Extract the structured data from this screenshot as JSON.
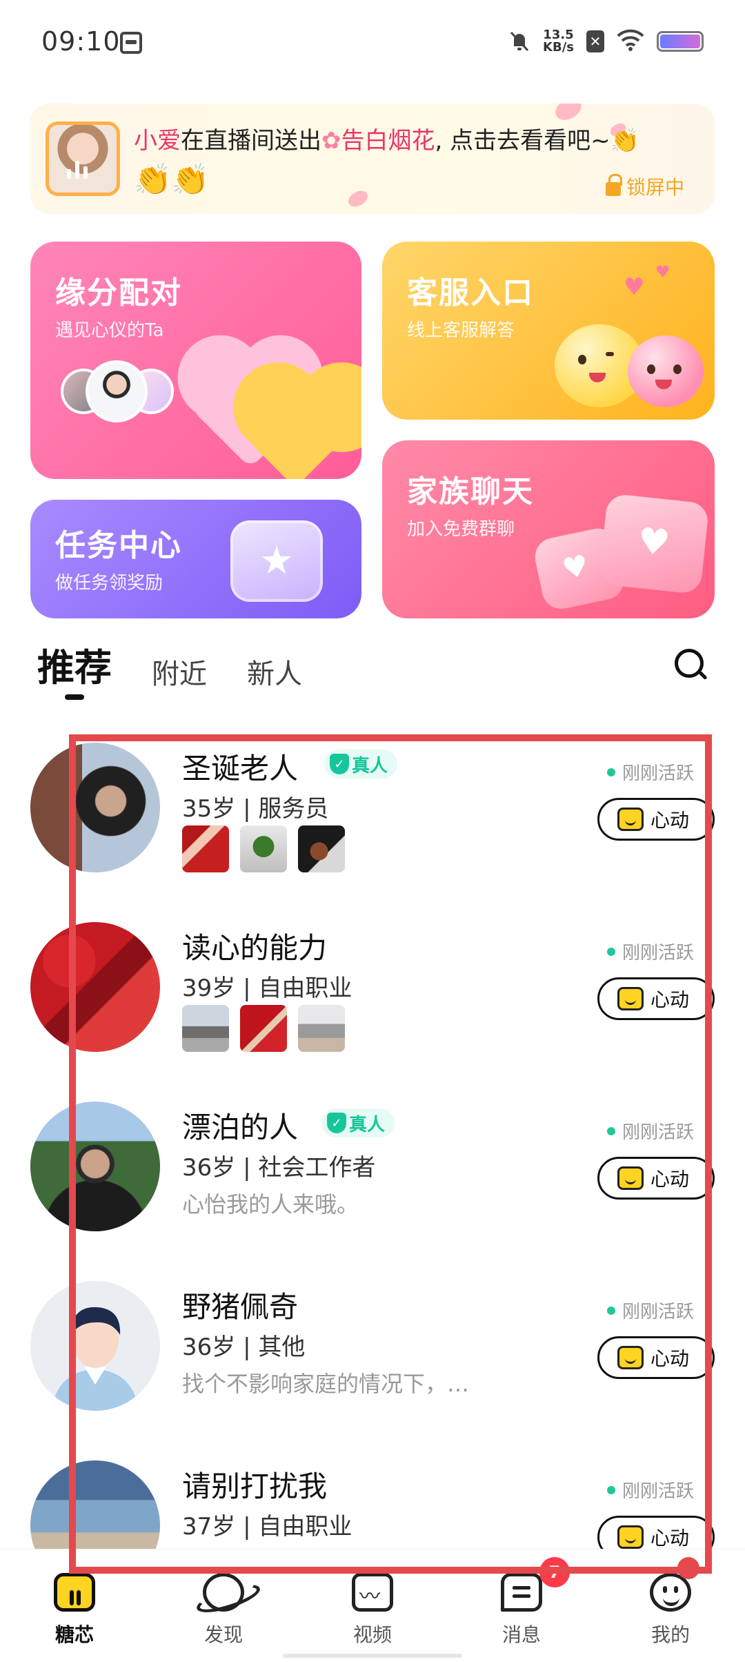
{
  "status_bar": {
    "time": "09:10",
    "net_speed_value": "13.5",
    "net_speed_unit": "KB/s",
    "x_badge": "✕"
  },
  "banner": {
    "sender": "小爱",
    "text_mid": "在直播间送出",
    "gift": "告白烟花",
    "text_end": ", 点击去看看吧~👏",
    "emojis": "👏👏",
    "lock_label": "锁屏中"
  },
  "cards": {
    "match": {
      "title": "缘分配对",
      "subtitle": "遇见心仪的Ta"
    },
    "service": {
      "title": "客服入口",
      "subtitle": "线上客服解答"
    },
    "task": {
      "title": "任务中心",
      "subtitle": "做任务领奖励"
    },
    "family": {
      "title": "家族聊天",
      "subtitle": "加入免费群聊"
    }
  },
  "tabs": [
    "推荐",
    "附近",
    "新人"
  ],
  "list": {
    "verified_label": "真人",
    "active_label": "刚刚活跃",
    "like_label": "心动",
    "users": [
      {
        "name": "圣诞老人",
        "meta": "35岁 | 服务员",
        "bio": ""
      },
      {
        "name": "读心的能力",
        "meta": "39岁 | 自由职业",
        "bio": ""
      },
      {
        "name": "漂泊的人",
        "meta": "36岁 | 社会工作者",
        "bio": "心怡我的人来哦。"
      },
      {
        "name": "野猪佩奇",
        "meta": "36岁 | 其他",
        "bio": "找个不影响家庭的情况下，…"
      },
      {
        "name": "请别打扰我",
        "meta": "37岁 | 自由职业",
        "bio": ""
      }
    ]
  },
  "bottom_nav": {
    "items": [
      "糖芯",
      "发现",
      "视频",
      "消息",
      "我的"
    ],
    "message_badge": "7"
  },
  "colors": {
    "accent_yellow": "#ffd321",
    "verified_green": "#16c69a",
    "highlight_red": "#e5484d"
  },
  "icons": [
    "search-icon",
    "like-icon",
    "shield-icon",
    "lock-icon",
    "home-icon",
    "planet-icon",
    "video-icon",
    "message-icon",
    "profile-icon"
  ]
}
